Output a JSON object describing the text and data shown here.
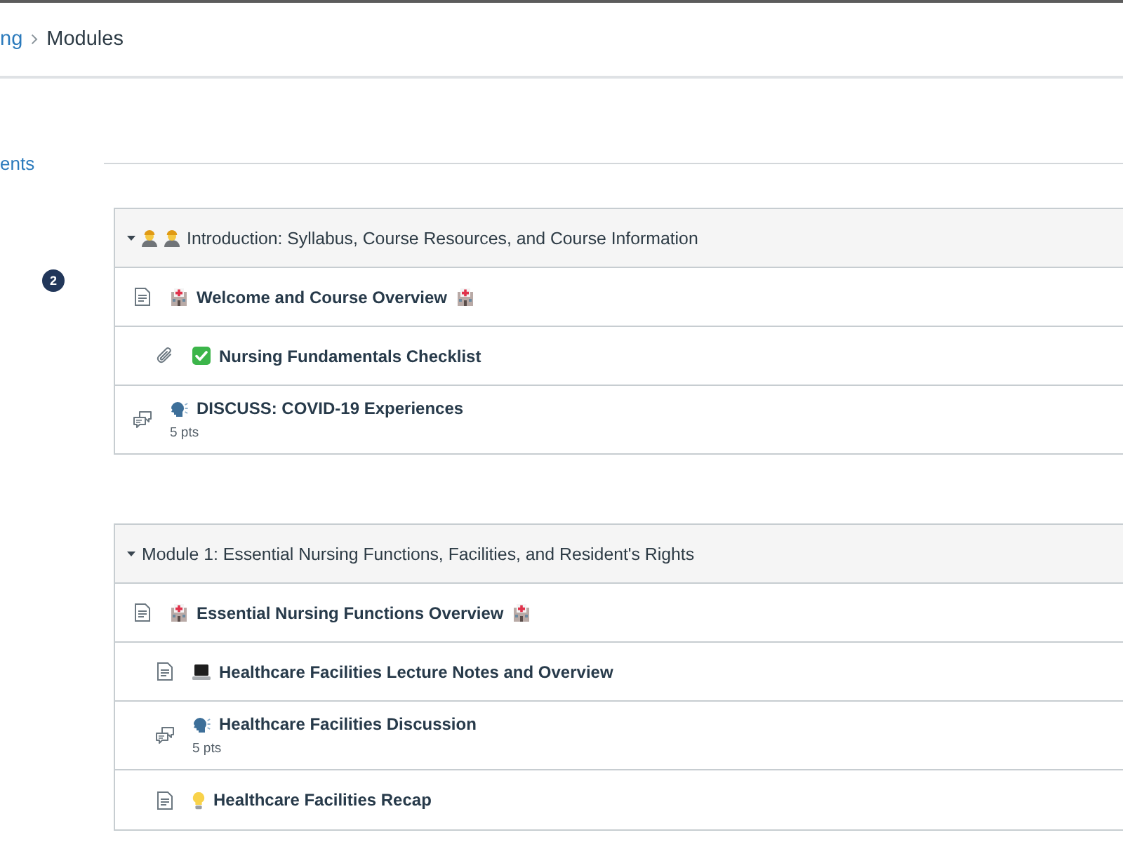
{
  "breadcrumb": [
    {
      "label": "ng",
      "current": false
    },
    {
      "label": "Modules",
      "current": true
    }
  ],
  "nav": {
    "label": "ents"
  },
  "badge": {
    "count": "2"
  },
  "modules": [
    {
      "title": "Introduction: Syllabus, Course Resources, and Course Information",
      "expanded": true,
      "emojis": [
        {
          "kind": "person"
        },
        {
          "kind": "person"
        }
      ],
      "items": [
        {
          "kind": "page",
          "title": "Welcome and Course Overview",
          "emojis": [
            {
              "kind": "hospital"
            }
          ],
          "trailing_emojis": [
            {
              "kind": "hospital"
            }
          ],
          "children": [
            {
              "kind": "attachment",
              "title": "Nursing Fundamentals Checklist",
              "emojis": [
                {
                  "kind": "check"
                }
              ]
            }
          ]
        },
        {
          "kind": "discussion",
          "title": "DISCUSS: COVID-19 Experiences",
          "emojis": [
            {
              "kind": "speaking-head"
            }
          ],
          "points": "5 pts"
        }
      ]
    },
    {
      "title": "Module 1: Essential Nursing Functions, Facilities, and Resident's Rights",
      "expanded": true,
      "items": [
        {
          "kind": "page",
          "title": "Essential Nursing Functions Overview",
          "emojis": [
            {
              "kind": "hospital"
            }
          ],
          "trailing_emojis": [
            {
              "kind": "hospital"
            }
          ],
          "children": [
            {
              "kind": "page",
              "title": "Healthcare Facilities Lecture Notes and Overview",
              "emojis": [
                {
                  "kind": "laptop"
                }
              ]
            },
            {
              "kind": "discussion",
              "title": "Healthcare Facilities Discussion",
              "emojis": [
                {
                  "kind": "speaking-head"
                }
              ],
              "points": "5 pts"
            },
            {
              "kind": "page",
              "title": "Healthcare Facilities Recap",
              "emojis": [
                {
                  "kind": "light-bulb"
                }
              ]
            }
          ]
        }
      ]
    }
  ]
}
